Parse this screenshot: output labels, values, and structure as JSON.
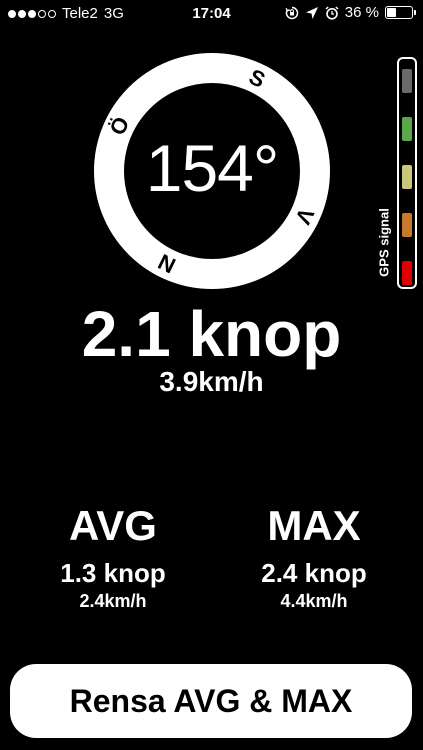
{
  "status_bar": {
    "carrier": "Tele2",
    "network": "3G",
    "time": "17:04",
    "battery": "36 %",
    "battery_level": 0.36,
    "signal_strength": 3,
    "signal_max": 5,
    "icons": [
      "orientation-lock-icon",
      "location-arrow-icon",
      "alarm-icon",
      "battery-icon"
    ]
  },
  "compass": {
    "heading": "154°",
    "heading_degrees": 154,
    "cardinals": {
      "south": "S",
      "west": "V",
      "north": "N",
      "east": "Ö"
    }
  },
  "gps": {
    "label": "GPS signal",
    "bars": [
      {
        "color": "#6a6a6a"
      },
      {
        "color": "#5aa84a"
      },
      {
        "color": "#c9c77a"
      },
      {
        "color": "#c8792b"
      },
      {
        "color": "#e00000"
      }
    ]
  },
  "speed": {
    "knots": "2.1 knop",
    "kmh": "3.9km/h"
  },
  "stats": {
    "avg": {
      "title": "AVG",
      "knots": "1.3 knop",
      "kmh": "2.4km/h"
    },
    "max": {
      "title": "MAX",
      "knots": "2.4 knop",
      "kmh": "4.4km/h"
    }
  },
  "reset_button": {
    "label": "Rensa AVG & MAX"
  }
}
